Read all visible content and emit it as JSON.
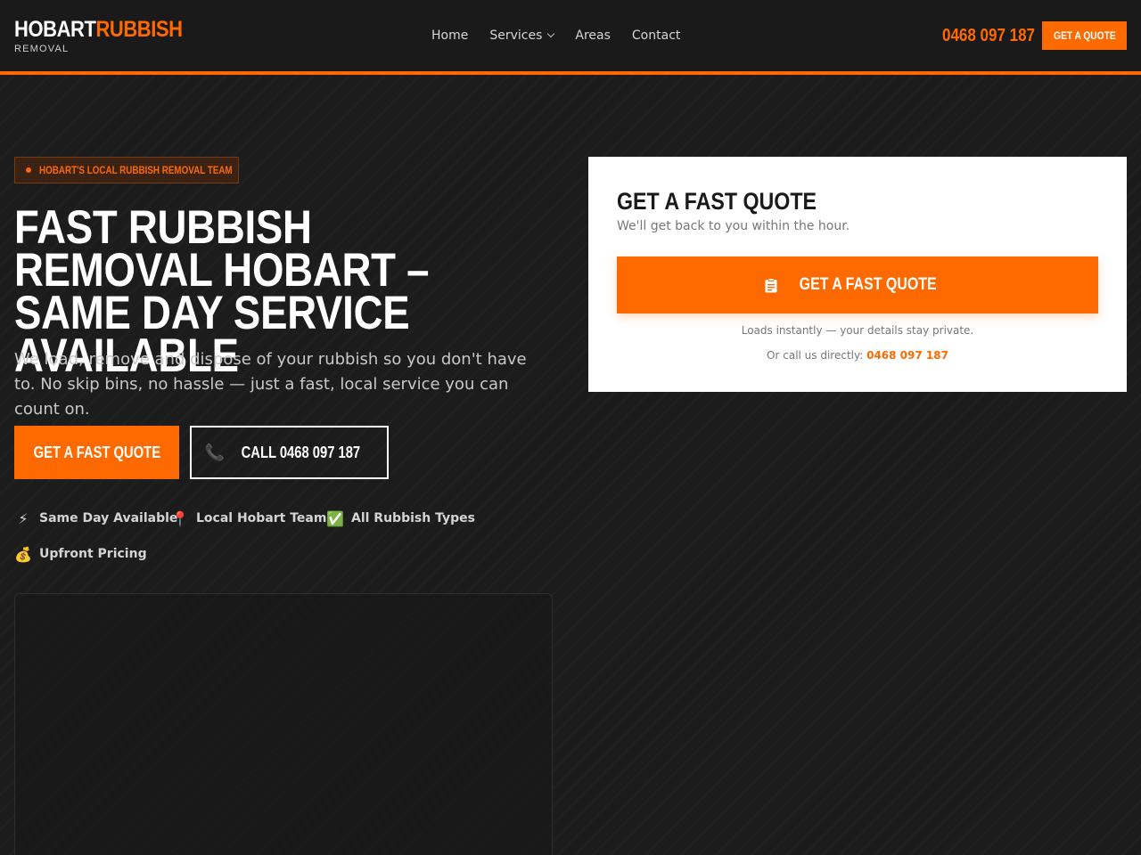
{
  "header": {
    "logo_main_white": "HOBART",
    "logo_main_orange": "RUBBISH",
    "logo_sub": "REMOVAL",
    "nav": [
      {
        "label": "Home"
      },
      {
        "label": "Services"
      },
      {
        "label": "Areas"
      },
      {
        "label": "Contact"
      }
    ],
    "phone": "0468 097 187",
    "cta_label": "GET A QUOTE"
  },
  "hero": {
    "badge": "HOBART'S LOCAL RUBBISH REMOVAL TEAM",
    "title": "FAST RUBBISH REMOVAL HOBART – SAME DAY SERVICE AVAILABLE",
    "subtitle": "We load, remove and dispose of your rubbish so you don't have to. No skip bins, no hassle — just a fast, local service you can count on.",
    "primary_button": "GET A FAST QUOTE",
    "secondary_button": "CALL 0468 097 187",
    "features": [
      {
        "icon": "lightning-icon",
        "glyph": "⚡",
        "label": "Same Day Available"
      },
      {
        "icon": "pin-icon",
        "glyph": "📍",
        "label": "Local Hobart Team"
      },
      {
        "icon": "check-icon",
        "glyph": "✅",
        "label": "All Rubbish Types"
      },
      {
        "icon": "money-bag-icon",
        "glyph": "💰",
        "label": "Upfront Pricing"
      }
    ]
  },
  "quote_card": {
    "title": "GET A FAST QUOTE",
    "subtitle": "We'll get back to you within the hour.",
    "button_label": "GET A FAST QUOTE",
    "note": "Loads instantly — your details stay private.",
    "call_prefix": "Or call us directly:",
    "call_number": "0468 097 187"
  },
  "colors": {
    "accent": "#ff6a00",
    "background": "#1c1c1c",
    "header_bg": "#1a1a1a",
    "card_bg": "#ffffff"
  }
}
